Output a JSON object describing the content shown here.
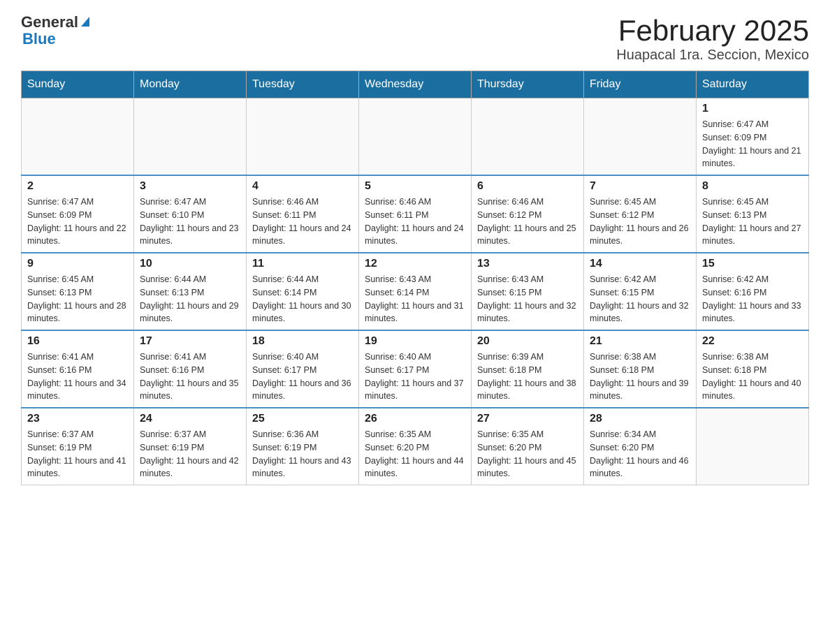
{
  "header": {
    "logo_general": "General",
    "logo_blue": "Blue",
    "title": "February 2025",
    "subtitle": "Huapacal 1ra. Seccion, Mexico"
  },
  "weekdays": [
    "Sunday",
    "Monday",
    "Tuesday",
    "Wednesday",
    "Thursday",
    "Friday",
    "Saturday"
  ],
  "weeks": [
    [
      {
        "day": "",
        "info": ""
      },
      {
        "day": "",
        "info": ""
      },
      {
        "day": "",
        "info": ""
      },
      {
        "day": "",
        "info": ""
      },
      {
        "day": "",
        "info": ""
      },
      {
        "day": "",
        "info": ""
      },
      {
        "day": "1",
        "info": "Sunrise: 6:47 AM\nSunset: 6:09 PM\nDaylight: 11 hours and 21 minutes."
      }
    ],
    [
      {
        "day": "2",
        "info": "Sunrise: 6:47 AM\nSunset: 6:09 PM\nDaylight: 11 hours and 22 minutes."
      },
      {
        "day": "3",
        "info": "Sunrise: 6:47 AM\nSunset: 6:10 PM\nDaylight: 11 hours and 23 minutes."
      },
      {
        "day": "4",
        "info": "Sunrise: 6:46 AM\nSunset: 6:11 PM\nDaylight: 11 hours and 24 minutes."
      },
      {
        "day": "5",
        "info": "Sunrise: 6:46 AM\nSunset: 6:11 PM\nDaylight: 11 hours and 24 minutes."
      },
      {
        "day": "6",
        "info": "Sunrise: 6:46 AM\nSunset: 6:12 PM\nDaylight: 11 hours and 25 minutes."
      },
      {
        "day": "7",
        "info": "Sunrise: 6:45 AM\nSunset: 6:12 PM\nDaylight: 11 hours and 26 minutes."
      },
      {
        "day": "8",
        "info": "Sunrise: 6:45 AM\nSunset: 6:13 PM\nDaylight: 11 hours and 27 minutes."
      }
    ],
    [
      {
        "day": "9",
        "info": "Sunrise: 6:45 AM\nSunset: 6:13 PM\nDaylight: 11 hours and 28 minutes."
      },
      {
        "day": "10",
        "info": "Sunrise: 6:44 AM\nSunset: 6:13 PM\nDaylight: 11 hours and 29 minutes."
      },
      {
        "day": "11",
        "info": "Sunrise: 6:44 AM\nSunset: 6:14 PM\nDaylight: 11 hours and 30 minutes."
      },
      {
        "day": "12",
        "info": "Sunrise: 6:43 AM\nSunset: 6:14 PM\nDaylight: 11 hours and 31 minutes."
      },
      {
        "day": "13",
        "info": "Sunrise: 6:43 AM\nSunset: 6:15 PM\nDaylight: 11 hours and 32 minutes."
      },
      {
        "day": "14",
        "info": "Sunrise: 6:42 AM\nSunset: 6:15 PM\nDaylight: 11 hours and 32 minutes."
      },
      {
        "day": "15",
        "info": "Sunrise: 6:42 AM\nSunset: 6:16 PM\nDaylight: 11 hours and 33 minutes."
      }
    ],
    [
      {
        "day": "16",
        "info": "Sunrise: 6:41 AM\nSunset: 6:16 PM\nDaylight: 11 hours and 34 minutes."
      },
      {
        "day": "17",
        "info": "Sunrise: 6:41 AM\nSunset: 6:16 PM\nDaylight: 11 hours and 35 minutes."
      },
      {
        "day": "18",
        "info": "Sunrise: 6:40 AM\nSunset: 6:17 PM\nDaylight: 11 hours and 36 minutes."
      },
      {
        "day": "19",
        "info": "Sunrise: 6:40 AM\nSunset: 6:17 PM\nDaylight: 11 hours and 37 minutes."
      },
      {
        "day": "20",
        "info": "Sunrise: 6:39 AM\nSunset: 6:18 PM\nDaylight: 11 hours and 38 minutes."
      },
      {
        "day": "21",
        "info": "Sunrise: 6:38 AM\nSunset: 6:18 PM\nDaylight: 11 hours and 39 minutes."
      },
      {
        "day": "22",
        "info": "Sunrise: 6:38 AM\nSunset: 6:18 PM\nDaylight: 11 hours and 40 minutes."
      }
    ],
    [
      {
        "day": "23",
        "info": "Sunrise: 6:37 AM\nSunset: 6:19 PM\nDaylight: 11 hours and 41 minutes."
      },
      {
        "day": "24",
        "info": "Sunrise: 6:37 AM\nSunset: 6:19 PM\nDaylight: 11 hours and 42 minutes."
      },
      {
        "day": "25",
        "info": "Sunrise: 6:36 AM\nSunset: 6:19 PM\nDaylight: 11 hours and 43 minutes."
      },
      {
        "day": "26",
        "info": "Sunrise: 6:35 AM\nSunset: 6:20 PM\nDaylight: 11 hours and 44 minutes."
      },
      {
        "day": "27",
        "info": "Sunrise: 6:35 AM\nSunset: 6:20 PM\nDaylight: 11 hours and 45 minutes."
      },
      {
        "day": "28",
        "info": "Sunrise: 6:34 AM\nSunset: 6:20 PM\nDaylight: 11 hours and 46 minutes."
      },
      {
        "day": "",
        "info": ""
      }
    ]
  ]
}
